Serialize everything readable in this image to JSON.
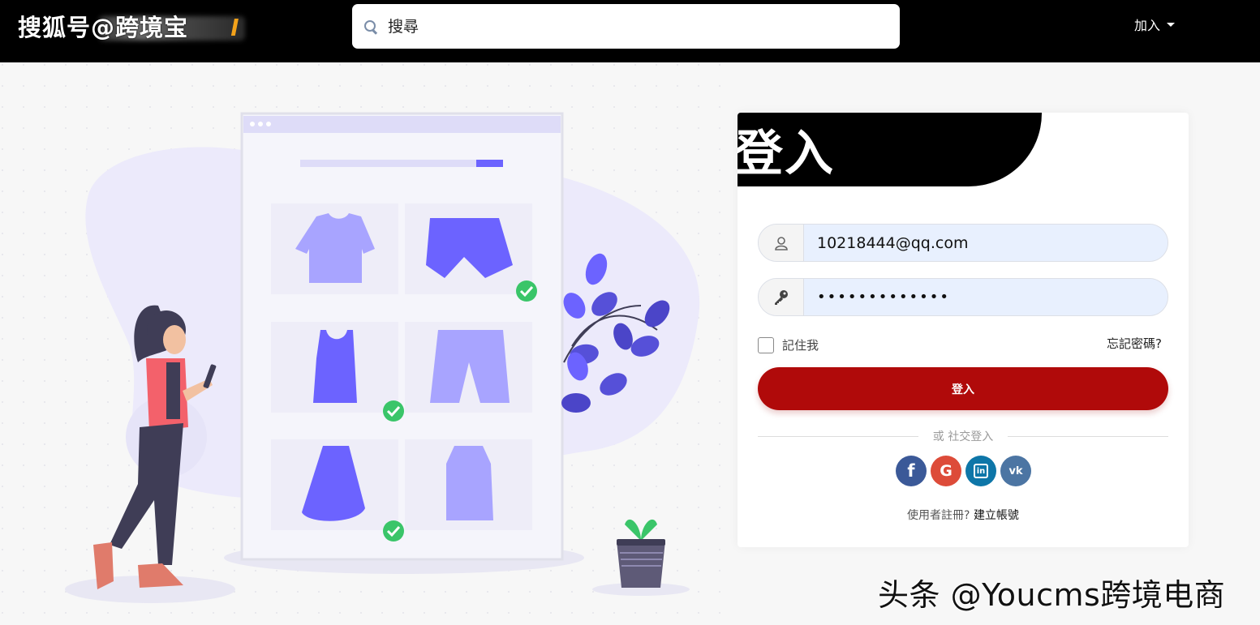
{
  "header": {
    "brand_text": "搜狐号@跨境宝",
    "brand_mark": "l",
    "search_placeholder": "搜尋",
    "join_label": "加入"
  },
  "login": {
    "title": "登入",
    "email_value": "10218444@qq.com",
    "password_value": "•••••••••••••",
    "remember_label": "記住我",
    "forgot_label": "忘記密碼?",
    "submit_label": "登入",
    "divider_label": "或 社交登入",
    "signup_prompt": "使用者註冊?",
    "signup_link": "建立帳號"
  },
  "socials": [
    {
      "name": "facebook",
      "glyph": "f",
      "color": "#3b5998"
    },
    {
      "name": "google",
      "glyph": "G",
      "color": "#dd4b39"
    },
    {
      "name": "linkedin",
      "glyph": "in",
      "color": "#0e76a8"
    },
    {
      "name": "vk",
      "glyph": "vk",
      "color": "#4c75a3"
    }
  ],
  "colors": {
    "topbar": "#000000",
    "primary_button": "#b00a0a",
    "illustration_purple": "#6c63ff",
    "illustration_light": "#a8a4ff",
    "check_green": "#3ac569"
  },
  "watermark": "头条 @Youcms跨境电商"
}
